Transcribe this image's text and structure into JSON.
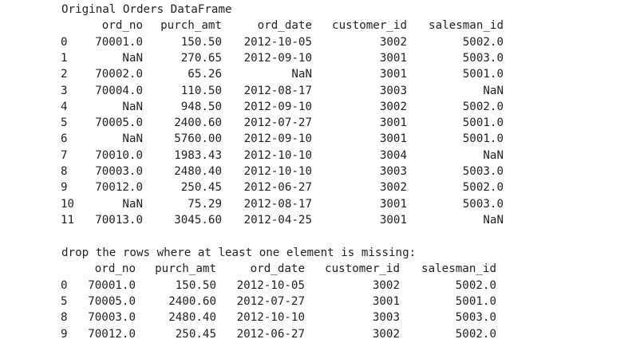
{
  "sections": [
    {
      "title": "Original Orders DataFrame",
      "columns": [
        "ord_no",
        "purch_amt",
        "ord_date",
        "customer_id",
        "salesman_id"
      ],
      "rows": [
        {
          "index": "0",
          "ord_no": "70001.0",
          "purch_amt": "150.50",
          "ord_date": "2012-10-05",
          "customer_id": "3002",
          "salesman_id": "5002.0"
        },
        {
          "index": "1",
          "ord_no": "NaN",
          "purch_amt": "270.65",
          "ord_date": "2012-09-10",
          "customer_id": "3001",
          "salesman_id": "5003.0"
        },
        {
          "index": "2",
          "ord_no": "70002.0",
          "purch_amt": "65.26",
          "ord_date": "NaN",
          "customer_id": "3001",
          "salesman_id": "5001.0"
        },
        {
          "index": "3",
          "ord_no": "70004.0",
          "purch_amt": "110.50",
          "ord_date": "2012-08-17",
          "customer_id": "3003",
          "salesman_id": "NaN"
        },
        {
          "index": "4",
          "ord_no": "NaN",
          "purch_amt": "948.50",
          "ord_date": "2012-09-10",
          "customer_id": "3002",
          "salesman_id": "5002.0"
        },
        {
          "index": "5",
          "ord_no": "70005.0",
          "purch_amt": "2400.60",
          "ord_date": "2012-07-27",
          "customer_id": "3001",
          "salesman_id": "5001.0"
        },
        {
          "index": "6",
          "ord_no": "NaN",
          "purch_amt": "5760.00",
          "ord_date": "2012-09-10",
          "customer_id": "3001",
          "salesman_id": "5001.0"
        },
        {
          "index": "7",
          "ord_no": "70010.0",
          "purch_amt": "1983.43",
          "ord_date": "2012-10-10",
          "customer_id": "3004",
          "salesman_id": "NaN"
        },
        {
          "index": "8",
          "ord_no": "70003.0",
          "purch_amt": "2480.40",
          "ord_date": "2012-10-10",
          "customer_id": "3003",
          "salesman_id": "5003.0"
        },
        {
          "index": "9",
          "ord_no": "70012.0",
          "purch_amt": "250.45",
          "ord_date": "2012-06-27",
          "customer_id": "3002",
          "salesman_id": "5002.0"
        },
        {
          "index": "10",
          "ord_no": "NaN",
          "purch_amt": "75.29",
          "ord_date": "2012-08-17",
          "customer_id": "3001",
          "salesman_id": "5003.0"
        },
        {
          "index": "11",
          "ord_no": "70013.0",
          "purch_amt": "3045.60",
          "ord_date": "2012-04-25",
          "customer_id": "3001",
          "salesman_id": "NaN"
        }
      ]
    },
    {
      "title": "drop the rows where at least one element is missing:",
      "columns": [
        "ord_no",
        "purch_amt",
        "ord_date",
        "customer_id",
        "salesman_id"
      ],
      "rows": [
        {
          "index": "0",
          "ord_no": "70001.0",
          "purch_amt": "150.50",
          "ord_date": "2012-10-05",
          "customer_id": "3002",
          "salesman_id": "5002.0"
        },
        {
          "index": "5",
          "ord_no": "70005.0",
          "purch_amt": "2400.60",
          "ord_date": "2012-07-27",
          "customer_id": "3001",
          "salesman_id": "5001.0"
        },
        {
          "index": "8",
          "ord_no": "70003.0",
          "purch_amt": "2480.40",
          "ord_date": "2012-10-10",
          "customer_id": "3003",
          "salesman_id": "5003.0"
        },
        {
          "index": "9",
          "ord_no": "70012.0",
          "purch_amt": "250.45",
          "ord_date": "2012-06-27",
          "customer_id": "3002",
          "salesman_id": "5002.0"
        }
      ]
    }
  ]
}
